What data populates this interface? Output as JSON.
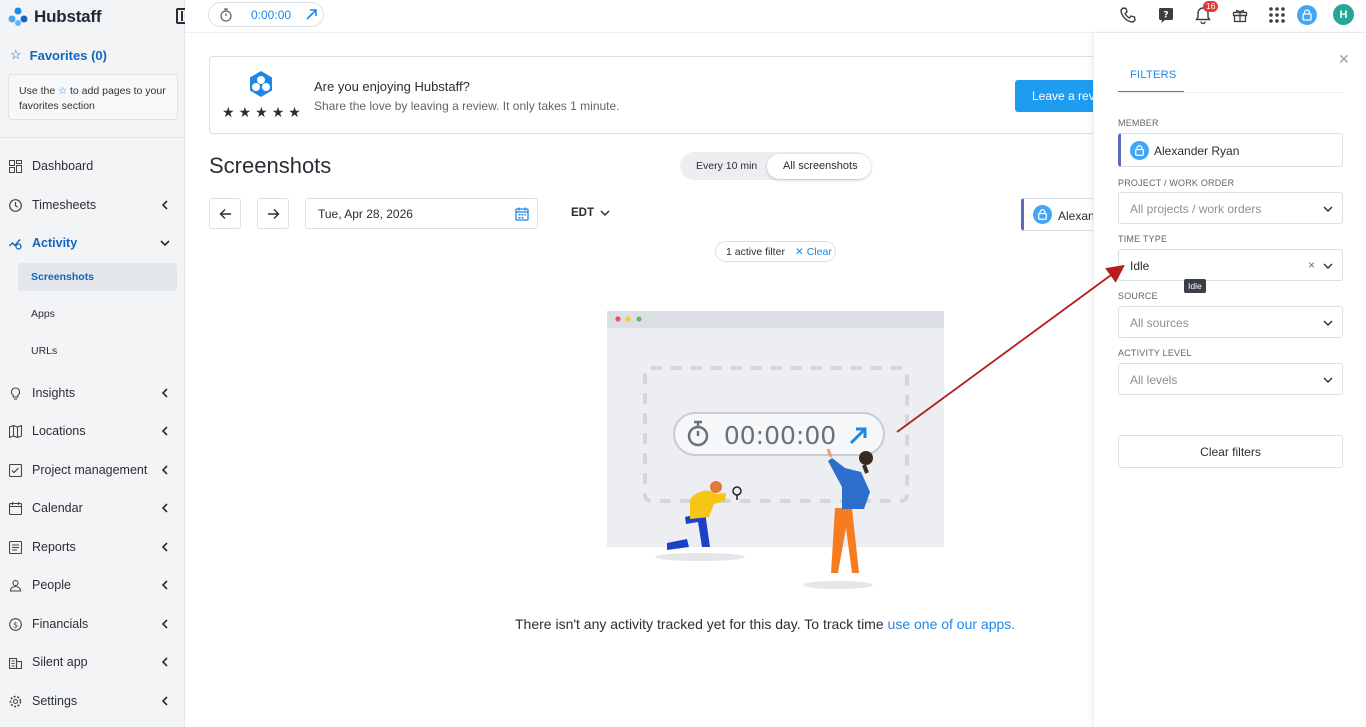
{
  "app": {
    "name": "Hubstaff"
  },
  "topbar": {
    "timer": "0:00:00",
    "notifications_count": "16",
    "user_initial": "H"
  },
  "sidebar": {
    "favorites_label": "Favorites (0)",
    "favorites_hint_pre": "Use the",
    "favorites_hint_post": "to add pages to your favorites section",
    "items": [
      {
        "label": "Dashboard",
        "icon": "dashboard-icon"
      },
      {
        "label": "Timesheets",
        "icon": "clock-icon"
      },
      {
        "label": "Activity",
        "icon": "activity-icon"
      },
      {
        "label": "Insights",
        "icon": "lightbulb-icon"
      },
      {
        "label": "Locations",
        "icon": "map-icon"
      },
      {
        "label": "Project management",
        "icon": "checklist-icon"
      },
      {
        "label": "Calendar",
        "icon": "calendar-icon"
      },
      {
        "label": "Reports",
        "icon": "report-icon"
      },
      {
        "label": "People",
        "icon": "person-icon"
      },
      {
        "label": "Financials",
        "icon": "dollar-icon"
      },
      {
        "label": "Silent app",
        "icon": "building-icon"
      },
      {
        "label": "Settings",
        "icon": "gear-icon"
      }
    ],
    "activity_sub": [
      "Screenshots",
      "Apps",
      "URLs"
    ]
  },
  "banner": {
    "title": "Are you enjoying Hubstaff?",
    "subtitle": "Share the love by leaving a review. It only takes 1 minute.",
    "button": "Leave a revi",
    "stars": 5
  },
  "main": {
    "title": "Screenshots",
    "seg_option_1": "Every 10 min",
    "seg_option_2": "All screenshots",
    "date": "Tue, Apr 28, 2026",
    "timezone": "EDT",
    "member": "Alexander Ryan",
    "active_filter": "1 active filter",
    "clear": "Clear",
    "illus_timer": "00:00:00",
    "empty_text": "There isn't any activity tracked yet for this day. To track time ",
    "empty_link": "use one of our apps."
  },
  "filters": {
    "tab": "FILTERS",
    "member_label": "MEMBER",
    "member_value": "Alexander Ryan",
    "project_label": "PROJECT / WORK ORDER",
    "project_placeholder": "All projects / work orders",
    "time_type_label": "TIME TYPE",
    "time_type_value": "Idle",
    "tooltip": "Idle",
    "source_label": "SOURCE",
    "source_placeholder": "All sources",
    "activity_label": "ACTIVITY LEVEL",
    "activity_placeholder": "All levels",
    "clear_button": "Clear filters"
  },
  "colors": {
    "accent": "#1e88e5",
    "annotation_arrow": "#b71c1c",
    "active_text": "#1565c0"
  }
}
